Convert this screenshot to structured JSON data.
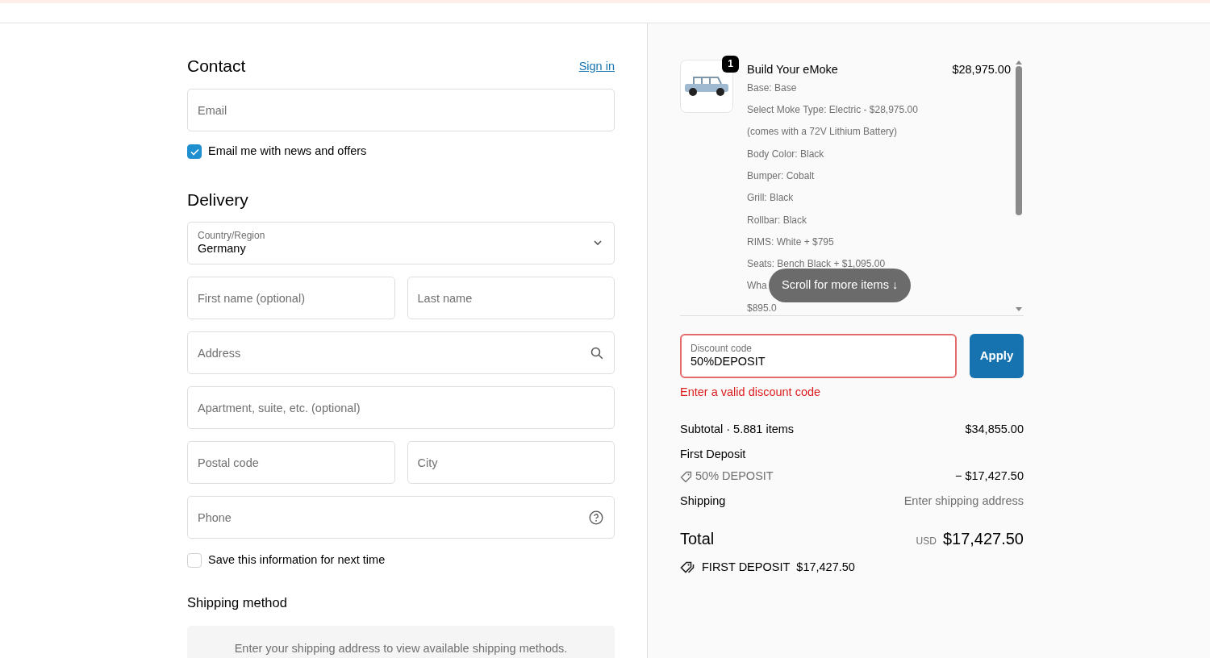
{
  "contact": {
    "title": "Contact",
    "sign_in": "Sign in",
    "email": {
      "placeholder": "Email"
    },
    "newsletter": {
      "label": "Email me with news and offers",
      "checked": true
    }
  },
  "delivery": {
    "title": "Delivery",
    "rows": [
      [
        {
          "kind": "select",
          "label": "Country/Region",
          "value": "Germany"
        }
      ],
      [
        {
          "kind": "text",
          "placeholder": "First name (optional)"
        },
        {
          "kind": "text",
          "placeholder": "Last name"
        }
      ],
      [
        {
          "kind": "search",
          "placeholder": "Address"
        }
      ],
      [
        {
          "kind": "text",
          "placeholder": "Apartment, suite, etc. (optional)"
        }
      ],
      [
        {
          "kind": "text",
          "placeholder": "Postal code"
        },
        {
          "kind": "text",
          "placeholder": "City"
        }
      ],
      [
        {
          "kind": "help",
          "placeholder": "Phone"
        }
      ]
    ],
    "save_info": {
      "label": "Save this information for next time",
      "checked": false
    }
  },
  "shipping_method": {
    "title": "Shipping method",
    "notice": "Enter your shipping address to view available shipping methods."
  },
  "order": {
    "product": {
      "quantity": "1",
      "title": "Build Your eMoke",
      "price": "$28,975.00",
      "options": [
        "Base: Base",
        "Select Moke Type: Electric - $28,975.00",
        "(comes with a 72V Lithium Battery)",
        "Body Color: Black",
        "Bumper: Cobalt",
        "Grill: Black",
        "Rollbar: Black",
        "RIMS: White + $795",
        "Seats: Bench Black + $1,095.00",
        "Wha",
        "$895.0"
      ]
    },
    "scroll_hint": "Scroll for more items ↓",
    "discount": {
      "label": "Discount code",
      "value": "50%DEPOSIT",
      "error": "Enter a valid discount code",
      "button": "Apply"
    },
    "subtotal": {
      "label": "Subtotal · 5.881 items",
      "value": "$34,855.00"
    },
    "deposit": {
      "label": "First Deposit",
      "code": "50% DEPOSIT",
      "value": "− $17,427.50"
    },
    "shipping": {
      "label": "Shipping",
      "value": "Enter shipping address"
    },
    "total": {
      "label": "Total",
      "currency": "USD",
      "value": "$17,427.50"
    },
    "savings": {
      "label": "FIRST DEPOSIT",
      "value": "$17,427.50"
    }
  }
}
